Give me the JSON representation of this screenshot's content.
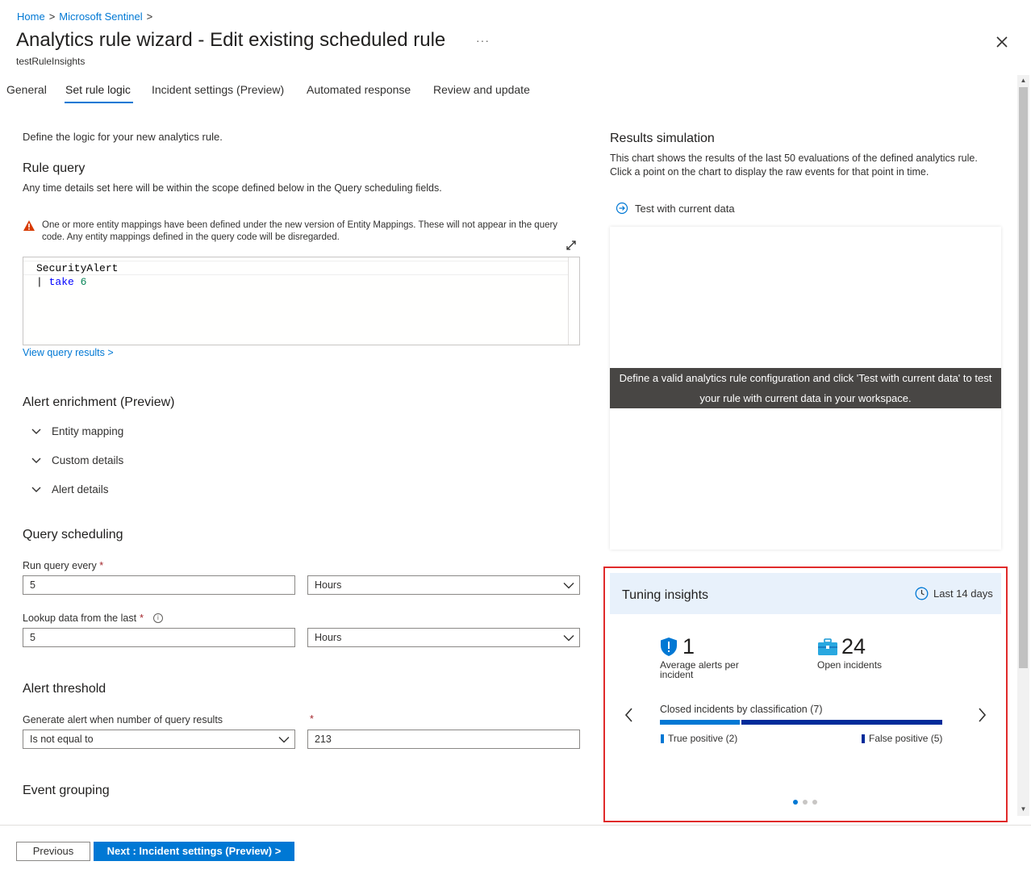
{
  "breadcrumb": {
    "home": "Home",
    "sep1": ">",
    "sentinel": "Microsoft Sentinel",
    "sep2": ">"
  },
  "header": {
    "title": "Analytics rule wizard - Edit existing scheduled rule",
    "ellipsis": "···",
    "subtitle": "testRuleInsights"
  },
  "tabs": [
    {
      "label": "General"
    },
    {
      "label": "Set rule logic"
    },
    {
      "label": "Incident settings (Preview)"
    },
    {
      "label": "Automated response"
    },
    {
      "label": "Review and update"
    }
  ],
  "logic": {
    "intro": "Define the logic for your new analytics rule.",
    "rule_query_title": "Rule query",
    "rule_query_desc": "Any time details set here will be within the scope defined below in the Query scheduling fields.",
    "warning": "One or more entity mappings have been defined under the new version of Entity Mappings. These will not appear in the query code. Any entity mappings defined in the query code will be disregarded.",
    "query_line1": "SecurityAlert",
    "query_pipe": "|",
    "query_kw": "take",
    "query_num": "6",
    "view_results": "View query results >"
  },
  "enrichment": {
    "title": "Alert enrichment (Preview)",
    "items": [
      {
        "label": "Entity mapping"
      },
      {
        "label": "Custom details"
      },
      {
        "label": "Alert details"
      }
    ]
  },
  "scheduling": {
    "title": "Query scheduling",
    "run_label": "Run query every",
    "run_value": "5",
    "run_unit": "Hours",
    "lookup_label": "Lookup data from the last",
    "lookup_value": "5",
    "lookup_unit": "Hours",
    "required_mark": "*",
    "info_glyph": "i"
  },
  "threshold": {
    "title": "Alert threshold",
    "label": "Generate alert when number of query results",
    "operator": "Is not equal to",
    "value": "213"
  },
  "grouping": {
    "title": "Event grouping"
  },
  "simulation": {
    "title": "Results simulation",
    "desc": "This chart shows the results of the last 50 evaluations of the defined analytics rule. Click a point on the chart to display the raw events for that point in time.",
    "test_button": "Test with current data",
    "banner": "Define a valid analytics rule configuration and click 'Test with current data' to test your rule with current data in your workspace."
  },
  "tuning": {
    "title": "Tuning insights",
    "period": "Last 14 days",
    "avg_alerts_value": "1",
    "avg_alerts_label": "Average alerts per incident",
    "open_incidents_value": "24",
    "open_incidents_label": "Open incidents",
    "closed_title": "Closed incidents by classification (7)",
    "true_positive": {
      "label": "True positive (2)",
      "count": 2,
      "color": "#0078d4"
    },
    "false_positive": {
      "label": "False positive (5)",
      "count": 5,
      "color": "#002b9a"
    },
    "page_index": 1,
    "page_count": 3
  },
  "footer": {
    "previous": "Previous",
    "next": "Next : Incident settings (Preview) >"
  },
  "colors": {
    "accent": "#0078d4",
    "warning": "#d83b01",
    "highlight_border": "#e02a2a"
  }
}
